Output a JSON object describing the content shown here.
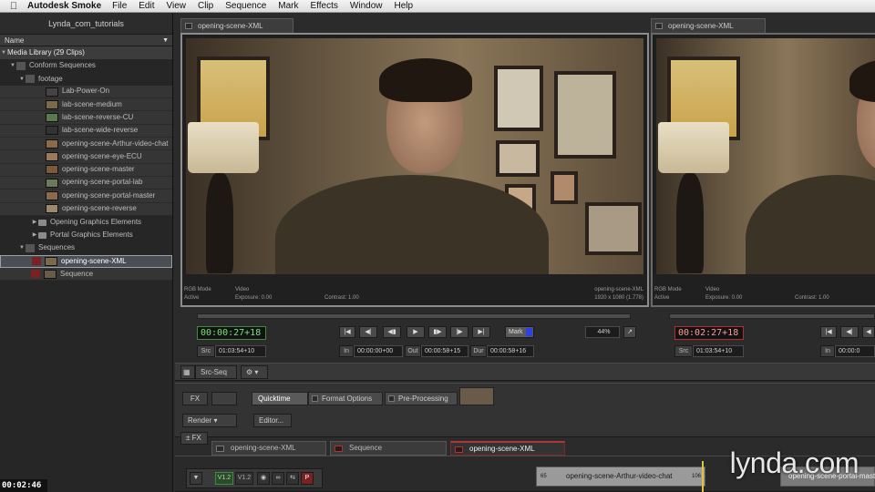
{
  "menubar": {
    "app_name": "Autodesk Smoke",
    "items": [
      "File",
      "Edit",
      "View",
      "Clip",
      "Sequence",
      "Mark",
      "Effects",
      "Window",
      "Help"
    ]
  },
  "library": {
    "title": "Lynda_com_tutorials",
    "column_header": "Name",
    "root": "Media Library (29 Clips)",
    "items": [
      {
        "label": "Conform Sequences"
      },
      {
        "label": "footage"
      },
      {
        "label": "Lab-Power-On"
      },
      {
        "label": "lab-scene-medium"
      },
      {
        "label": "lab-scene-reverse-CU"
      },
      {
        "label": "lab-scene-wide-reverse"
      },
      {
        "label": "opening-scene-Arthur-video-chat"
      },
      {
        "label": "opening-scene-eye-ECU"
      },
      {
        "label": "opening-scene-master"
      },
      {
        "label": "opening-scene-portal-lab"
      },
      {
        "label": "opening-scene-portal-master"
      },
      {
        "label": "opening-scene-reverse"
      },
      {
        "label": "Opening Graphics Elements"
      },
      {
        "label": "Portal Graphics Elements"
      },
      {
        "label": "Sequences"
      },
      {
        "label": "opening-scene-XML"
      },
      {
        "label": "Sequence"
      }
    ]
  },
  "corner_timecode": "00:02:46",
  "viewer_left": {
    "tab": "opening-scene-XML",
    "info": {
      "rgb_mode": "RGB Mode",
      "video": "Video",
      "active": "Active",
      "exposure": "Exposure: 0.00",
      "contrast": "Contrast: 1.00",
      "clip_name": "opening-scene-XML",
      "resolution": "1920 x 1080 (1.778)"
    }
  },
  "viewer_right": {
    "tab": "opening-scene-XML",
    "info": {
      "rgb_mode": "RGB Mode",
      "video": "Video",
      "active": "Active",
      "exposure": "Exposure: 0.00",
      "contrast": "Contrast: 1.00"
    }
  },
  "transport_left": {
    "timecode": "00:00:27+18",
    "src_label": "Src",
    "src_value": "01:03:54+10",
    "in_label": "In",
    "in_value": "00:00:00+00",
    "out_label": "Out",
    "out_value": "00:00:58+15",
    "dur_label": "Dur",
    "dur_value": "00:00:58+16",
    "mark_label": "Mark",
    "zoom": "44%"
  },
  "transport_right": {
    "timecode": "00:02:27+18",
    "src_label": "Src",
    "src_value": "01:03:54+10",
    "in_label": "In",
    "in_value": "00:00:0"
  },
  "toolbar": {
    "src_seq": "Src-Seq",
    "fx": "FX",
    "render": "Render",
    "fx_toggle": "± FX"
  },
  "tool_tabs": {
    "quicktime": "Quicktime",
    "format_options": "Format Options",
    "pre_processing": "Pre-Processing",
    "editor": "Editor..."
  },
  "seq_tabs": [
    "opening-scene-XML",
    "Sequence",
    "opening-scene-XML"
  ],
  "track": {
    "v1_2_active": "V1.2",
    "v1_2": "V1.2",
    "p": "P"
  },
  "clips": [
    {
      "num": "65",
      "name": "opening-scene-Arthur-video-chat",
      "end": "106"
    },
    {
      "name": "opening-scene-portal-master"
    }
  ],
  "watermark": "lynda.com",
  "colors": {
    "accent_green": "#7be07b",
    "accent_red": "#b03030",
    "mark_blue": "#2c3fe8"
  }
}
